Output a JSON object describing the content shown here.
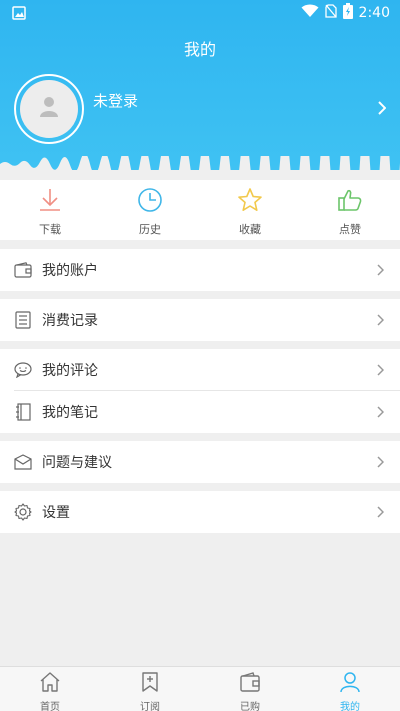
{
  "status_bar": {
    "time": "2:40"
  },
  "header": {
    "title": "我的",
    "login_text": "未登录"
  },
  "quick_actions": [
    {
      "label": "下载",
      "icon": "download-icon",
      "color": "#f08f84"
    },
    {
      "label": "历史",
      "icon": "clock-icon",
      "color": "#3fb6e8"
    },
    {
      "label": "收藏",
      "icon": "star-icon",
      "color": "#f2c94c"
    },
    {
      "label": "点赞",
      "icon": "thumbs-up-icon",
      "color": "#6cc56a"
    }
  ],
  "menu": {
    "account": "我的账户",
    "records": "消费记录",
    "comments": "我的评论",
    "notes": "我的笔记",
    "feedback": "问题与建议",
    "settings": "设置"
  },
  "tabbar": {
    "home": "首页",
    "subscribe": "订阅",
    "purchased": "已购",
    "mine": "我的",
    "active_color": "#2fb5f0"
  }
}
